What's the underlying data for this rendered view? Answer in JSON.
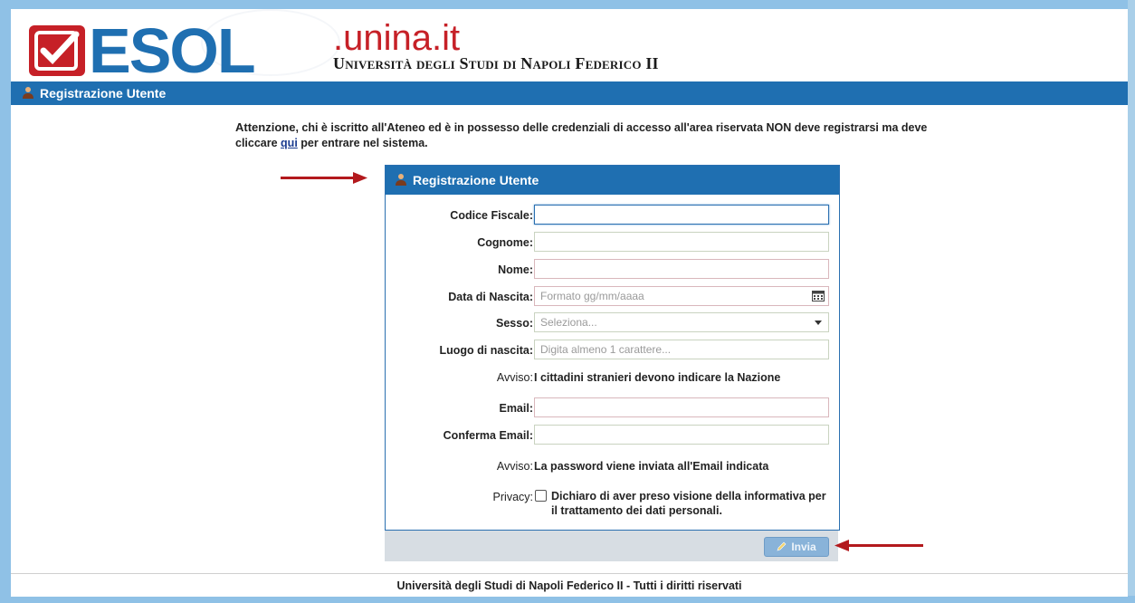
{
  "header": {
    "logo_text": "ESOL",
    "brand_domain": ".unina.it",
    "brand_university": "Università degli Studi di Napoli Federico II"
  },
  "titlebar": {
    "title": "Registrazione Utente"
  },
  "notice": {
    "bold_lead": "Attenzione",
    "text_before_link": ", chi è iscritto all'Ateneo ed è in possesso delle credenziali di accesso all'area riservata NON deve registrarsi ma deve cliccare ",
    "link_text": "qui",
    "text_after_link": " per entrare nel sistema."
  },
  "form": {
    "title": "Registrazione Utente",
    "fields": {
      "codice_fiscale": {
        "label": "Codice Fiscale:",
        "value": ""
      },
      "cognome": {
        "label": "Cognome:",
        "value": ""
      },
      "nome": {
        "label": "Nome:",
        "value": ""
      },
      "data_nascita": {
        "label": "Data di Nascita:",
        "placeholder": "Formato gg/mm/aaaa"
      },
      "sesso": {
        "label": "Sesso:",
        "placeholder": "Seleziona..."
      },
      "luogo_nascita": {
        "label": "Luogo di nascita:",
        "placeholder": "Digita almeno 1 carattere..."
      },
      "avviso_1": {
        "label": "Avviso:",
        "text": "I cittadini stranieri devono indicare la Nazione"
      },
      "email": {
        "label": "Email:",
        "value": ""
      },
      "conferma_email": {
        "label": "Conferma Email:",
        "value": ""
      },
      "avviso_2": {
        "label": "Avviso:",
        "text": "La password viene inviata all'Email indicata"
      },
      "privacy": {
        "label": "Privacy:",
        "text": "Dichiaro di aver preso visione della informativa per il trattamento dei dati personali."
      }
    },
    "submit_label": "Invia"
  },
  "footer": {
    "text": "Università degli Studi di Napoli Federico II - Tutti i diritti riservati"
  },
  "colors": {
    "brand_blue": "#1f6fb1",
    "brand_red": "#c62027",
    "arrow_red": "#b3191d"
  },
  "icons": [
    "user-icon",
    "calendar-icon",
    "chevron-down-icon",
    "pencil-icon",
    "checkmark-icon"
  ]
}
